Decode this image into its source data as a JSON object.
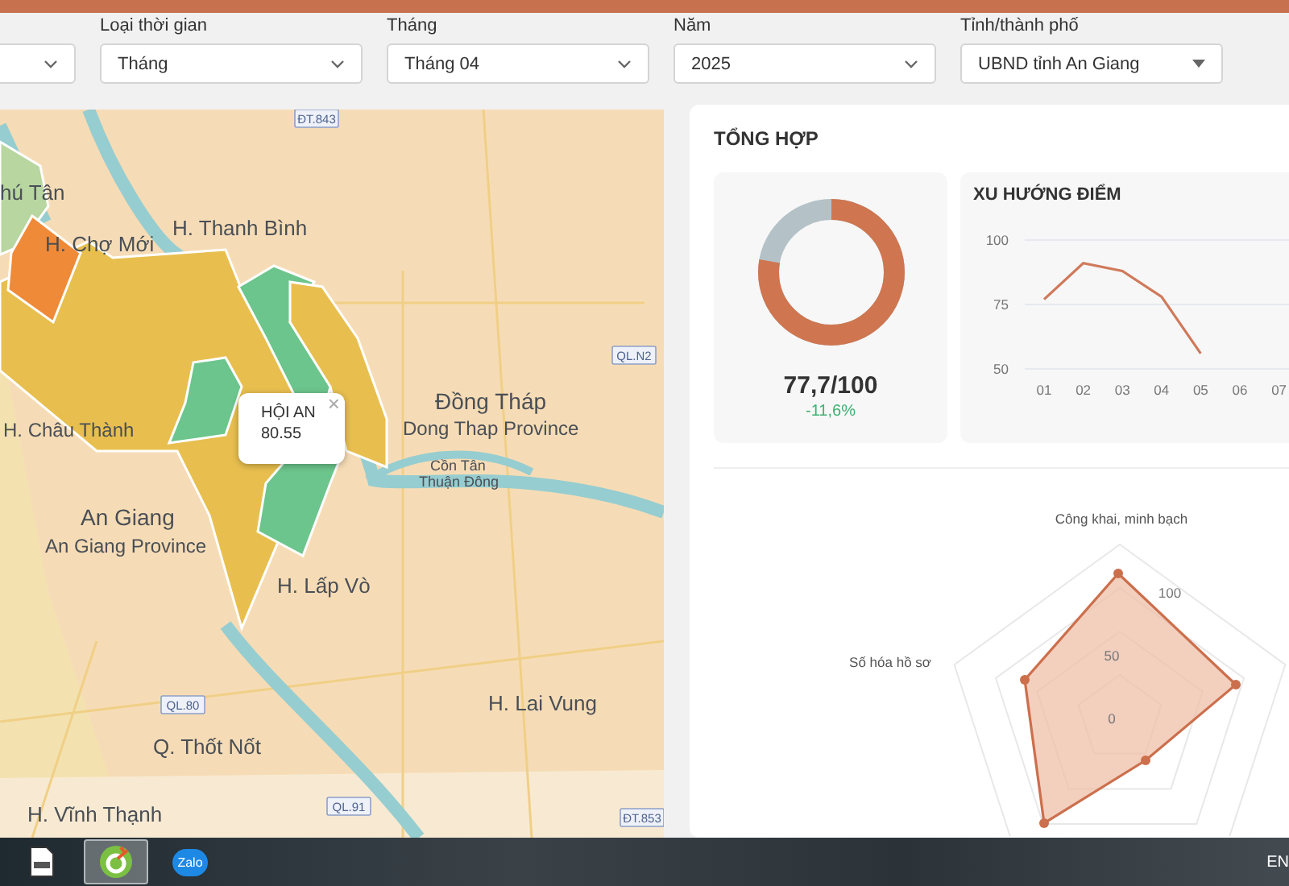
{
  "filters": [
    {
      "kind": "chevron"
    },
    {
      "kind": "chevron",
      "label": "Loại thời gian",
      "value": "Tháng"
    },
    {
      "kind": "chevron",
      "label": "Tháng",
      "value": "Tháng 04"
    },
    {
      "kind": "chevron",
      "label": "Năm",
      "value": "2025"
    },
    {
      "kind": "triangle",
      "label": "Tỉnh/thành phố",
      "value": "UBND tỉnh An Giang"
    }
  ],
  "map": {
    "regions": [
      {
        "color": "#b8d6a0"
      },
      {
        "color": "#e8bf4f"
      },
      {
        "color": "#ef8a38"
      },
      {
        "color": "#6cc58c"
      },
      {
        "color": "#e8bf4f"
      },
      {
        "color": "#6cc58c"
      },
      {
        "color": "#6cc58c"
      }
    ],
    "place_labels": [
      "hú Tân",
      "H. Chợ Mới",
      "H. Thanh Bình",
      "Đồng Tháp",
      "Dong Thap Province",
      "Cồn Tân",
      "Thuận Đông",
      "H. Châu Thành",
      "An Giang",
      "An Giang Province",
      "H. Lấp Vò",
      "H. Lai Vung",
      "Q. Thốt Nốt",
      "H. Vĩnh Thạnh"
    ],
    "road_badges": [
      "ĐT.843",
      "QL.N2",
      "QL.80",
      "QL.91",
      "ĐT.853"
    ],
    "popup": {
      "name": "HỘI AN",
      "score": "80.55",
      "close": "×"
    }
  },
  "summary": {
    "title": "TỔNG HỢP",
    "score_donut": {
      "level": 0.777,
      "score": "77,7/100",
      "change": "-11,6%"
    },
    "trend": {
      "title": "XU HƯỚNG ĐIỂM",
      "chart_data": {
        "type": "line",
        "categories": [
          "01",
          "02",
          "03",
          "04",
          "05",
          "06",
          "07"
        ],
        "series": [
          {
            "color": "#d0795a",
            "values": [
              77,
              91,
              88,
              78,
              56,
              null,
              null
            ]
          }
        ],
        "ylim": [
          50,
          100
        ],
        "yticks": [
          50,
          75,
          100
        ]
      }
    },
    "radar": {
      "axis_labels": [
        "Công khai, minh bạch",
        "Số hóa hồ sơ"
      ],
      "ticks": [
        "100",
        "50",
        "0"
      ]
    }
  },
  "taskbar": {
    "language": "EN",
    "apps": [
      {
        "kind": "file",
        "selected": false
      },
      {
        "kind": "green",
        "selected": true
      },
      {
        "kind": "zalo",
        "label": "Zalo",
        "selected": false
      }
    ]
  }
}
